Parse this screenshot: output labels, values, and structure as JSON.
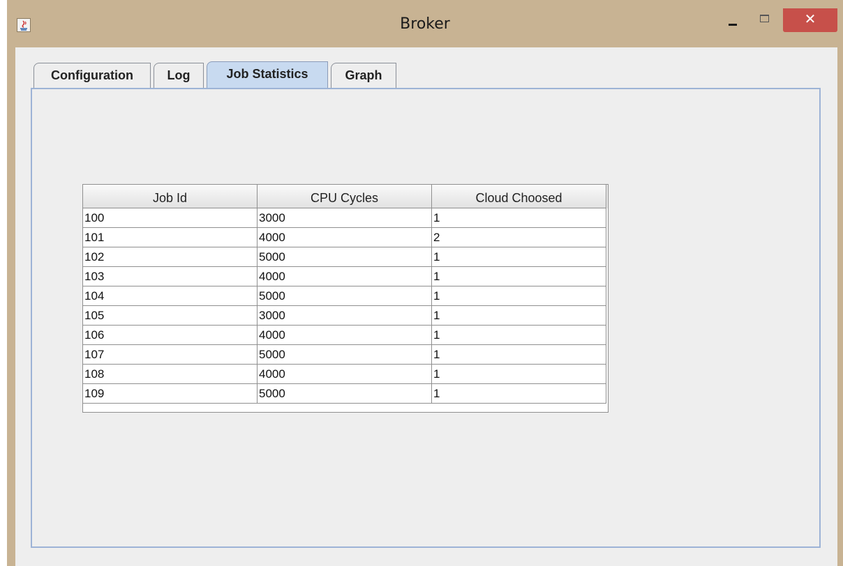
{
  "window": {
    "title": "Broker",
    "close_glyph": "✕",
    "accent_close": "#c7504a"
  },
  "tabs": [
    {
      "label": "Configuration",
      "active": false
    },
    {
      "label": "Log",
      "active": false
    },
    {
      "label": "Job Statistics",
      "active": true
    },
    {
      "label": "Graph",
      "active": false
    }
  ],
  "table": {
    "columns": [
      "Job Id",
      "CPU Cycles",
      "Cloud Choosed"
    ],
    "rows": [
      [
        "100",
        "3000",
        "1"
      ],
      [
        "101",
        "4000",
        "2"
      ],
      [
        "102",
        "5000",
        "1"
      ],
      [
        "103",
        "4000",
        "1"
      ],
      [
        "104",
        "5000",
        "1"
      ],
      [
        "105",
        "3000",
        "1"
      ],
      [
        "106",
        "4000",
        "1"
      ],
      [
        "107",
        "5000",
        "1"
      ],
      [
        "108",
        "4000",
        "1"
      ],
      [
        "109",
        "5000",
        "1"
      ]
    ]
  }
}
